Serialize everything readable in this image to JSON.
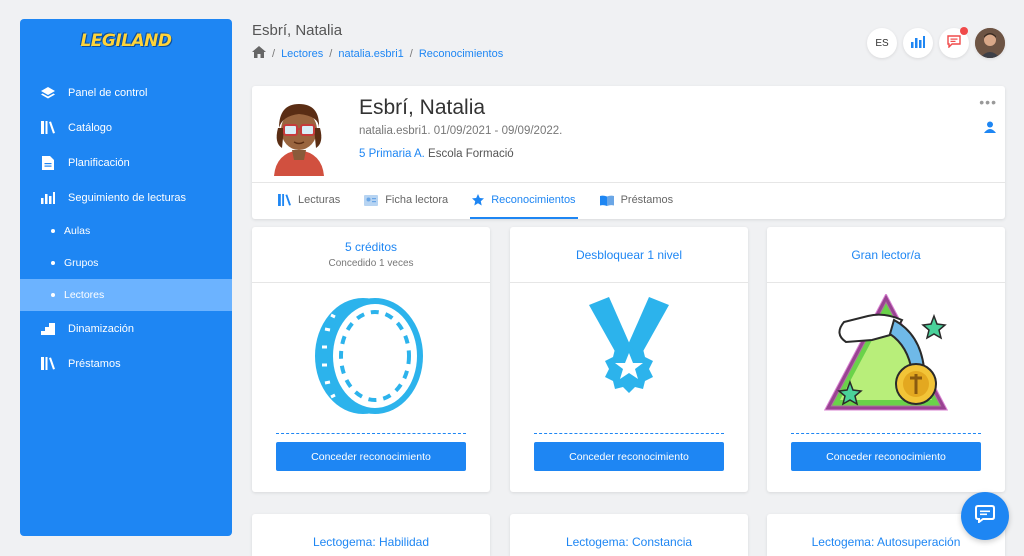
{
  "sidebar": {
    "logo": "LEGILAND",
    "items": [
      {
        "label": "Panel de control",
        "icon": "diamond-layers-icon"
      },
      {
        "label": "Catálogo",
        "icon": "books-icon"
      },
      {
        "label": "Planificación",
        "icon": "document-icon"
      },
      {
        "label": "Seguimiento de lecturas",
        "icon": "bar-chart-icon"
      }
    ],
    "sub_items": [
      {
        "label": "Aulas"
      },
      {
        "label": "Grupos"
      },
      {
        "label": "Lectores",
        "active": true
      }
    ],
    "items_after": [
      {
        "label": "Dinamización",
        "icon": "steps-icon"
      },
      {
        "label": "Préstamos",
        "icon": "books-icon"
      }
    ]
  },
  "header": {
    "title": "Esbrí, Natalia",
    "breadcrumb": [
      "Lectores",
      "natalia.esbri1",
      "Reconocimientos"
    ],
    "language": "ES"
  },
  "profile": {
    "name": "Esbrí, Natalia",
    "meta": "natalia.esbri1. 01/09/2021 - 09/09/2022.",
    "class_name": "5 Primaria A.",
    "school": "Escola Formació",
    "menu_glyph": "•••"
  },
  "tabs": [
    {
      "label": "Lecturas",
      "icon": "books-icon"
    },
    {
      "label": "Ficha lectora",
      "icon": "id-card-icon"
    },
    {
      "label": "Reconocimientos",
      "icon": "star-icon",
      "active": true
    },
    {
      "label": "Préstamos",
      "icon": "book-open-icon"
    }
  ],
  "cards": [
    {
      "title": "5 créditos",
      "subtitle": "Concedido 1 veces",
      "image": "coin-icon",
      "button": "Conceder reconocimiento"
    },
    {
      "title": "Desbloquear 1 nivel",
      "subtitle": "",
      "image": "medal-icon",
      "button": "Conceder reconocimiento"
    },
    {
      "title": "Gran lector/a",
      "subtitle": "",
      "image": "trophy-badge-icon",
      "button": "Conceder reconocimiento"
    }
  ],
  "cards_row2": [
    {
      "title": "Lectogema: Habilidad"
    },
    {
      "title": "Lectogema: Constancia"
    },
    {
      "title": "Lectogema: Autosuperación"
    }
  ],
  "colors": {
    "primary": "#1e86f3",
    "sidebar_active": "#6cb3ff",
    "badge": "#f04a4a",
    "logo": "#ffd43a"
  }
}
